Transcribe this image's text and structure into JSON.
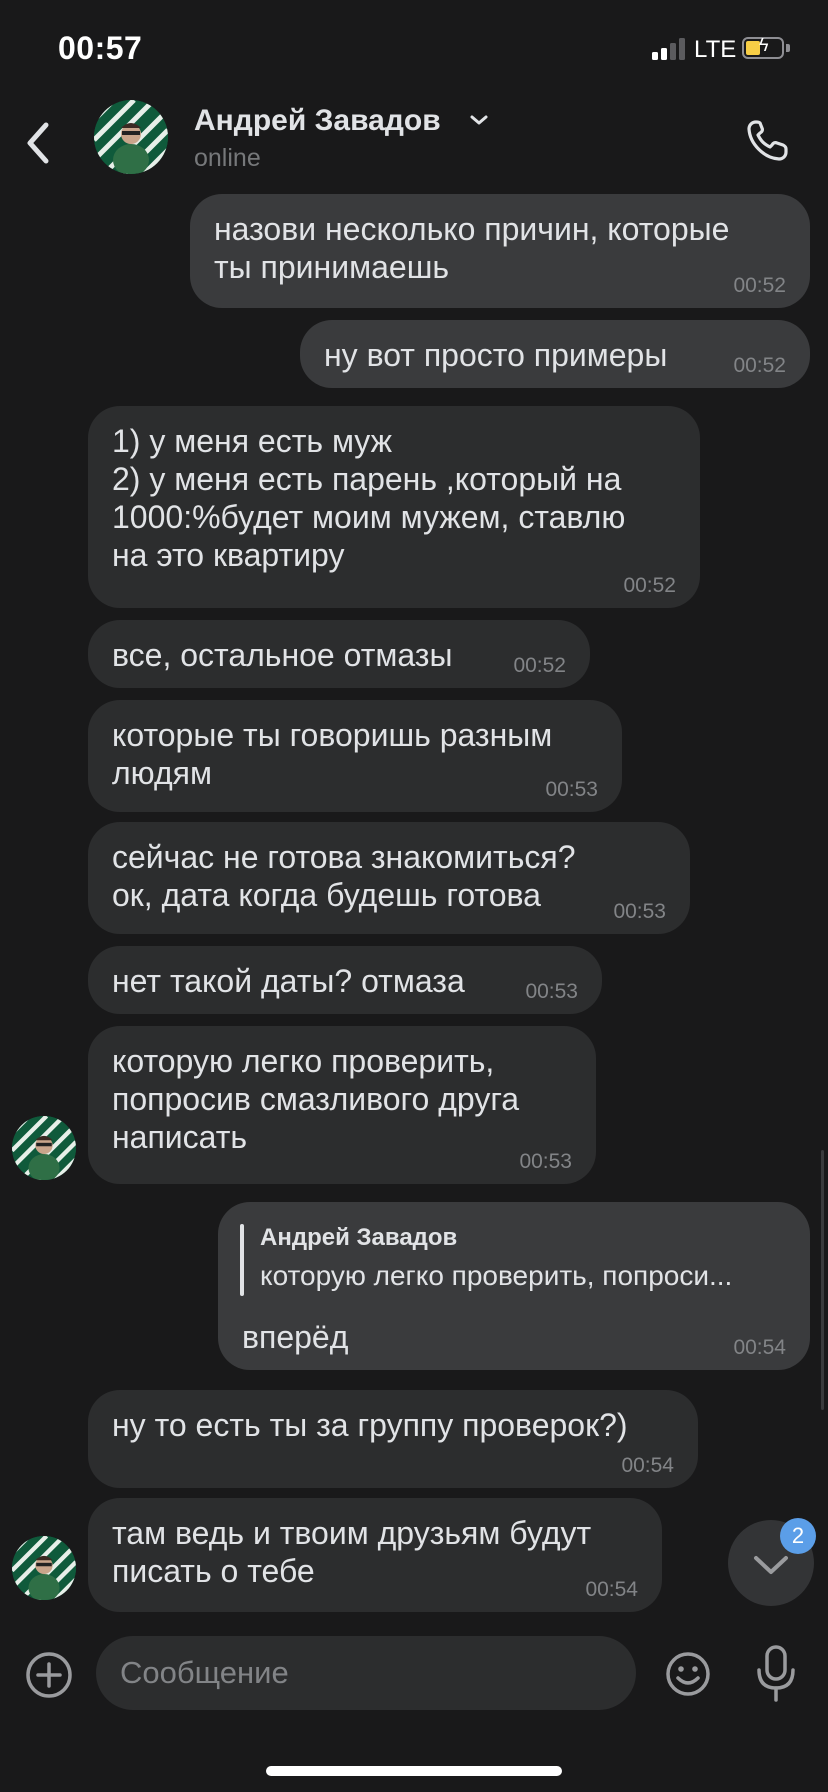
{
  "status_bar": {
    "time": "00:57",
    "network": "LTE"
  },
  "header": {
    "contact_name": "Андрей Завадов",
    "contact_status": "online",
    "icons": {
      "back": "back-chevron-icon",
      "dropdown": "chevron-down-icon",
      "call": "phone-icon"
    }
  },
  "messages": [
    {
      "direction": "outgoing",
      "text": "назови несколько причин, которые\nты принимаешь",
      "time": "00:52"
    },
    {
      "direction": "outgoing",
      "text": "ну вот просто примеры",
      "time": "00:52"
    },
    {
      "direction": "incoming",
      "text": "1) у меня есть муж\n2) у меня есть парень ,который на\n1000:%будет моим мужем, ставлю\nна это квартиру",
      "time": "00:52"
    },
    {
      "direction": "incoming",
      "text": "все, остальное отмазы",
      "time": "00:52"
    },
    {
      "direction": "incoming",
      "text": "которые ты говоришь разным\nлюдям",
      "time": "00:53"
    },
    {
      "direction": "incoming",
      "text": "сейчас не готова знакомиться?\nок, дата когда будешь готова",
      "time": "00:53"
    },
    {
      "direction": "incoming",
      "text": "нет такой даты? отмаза",
      "time": "00:53"
    },
    {
      "direction": "incoming",
      "text": "которую легко проверить,\nпопросив смазливого друга\nнаписать",
      "time": "00:53"
    },
    {
      "direction": "outgoing",
      "reply_to": {
        "author": "Андрей Завадов",
        "text": "которую легко проверить, попроси..."
      },
      "text": "вперёд",
      "time": "00:54"
    },
    {
      "direction": "incoming",
      "text": "ну то есть ты за группу проверок?)",
      "time": "00:54"
    },
    {
      "direction": "incoming",
      "text": "там ведь и твоим друзьям будут\nписать о тебе",
      "time": "00:54"
    }
  ],
  "scroll_down": {
    "unread_count": "2",
    "icon": "chevron-down-icon"
  },
  "composer": {
    "placeholder": "Сообщение",
    "icons": {
      "add": "plus-circle-icon",
      "emoji": "smile-icon",
      "mic": "microphone-icon"
    }
  },
  "colors": {
    "background": "#19191a",
    "incoming_bubble": "#2c2d2e",
    "outgoing_bubble": "#3a3b3d",
    "text": "#e1e3e6",
    "muted": "#828487",
    "badge": "#5b9ee8",
    "battery": "#f7ce46"
  }
}
